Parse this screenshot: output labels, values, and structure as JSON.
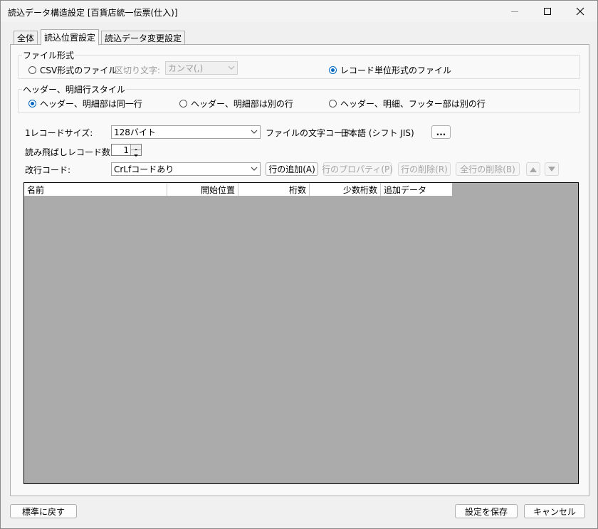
{
  "window": {
    "title": "読込データ構造設定 [百貨店統一伝票(仕入)]"
  },
  "tabs": [
    {
      "label": "全体"
    },
    {
      "label": "読込位置設定"
    },
    {
      "label": "読込データ変更設定"
    }
  ],
  "file_format": {
    "legend": "ファイル形式",
    "csv_label": "CSV形式のファイル",
    "delimiter_label": "区切り文字:",
    "delimiter_value": "カンマ(,)",
    "record_label": "レコード単位形式のファイル",
    "selected": "record"
  },
  "header_style": {
    "legend": "ヘッダー、明細行スタイル",
    "options": [
      {
        "label": "ヘッダー、明細部は同一行"
      },
      {
        "label": "ヘッダー、明細部は別の行"
      },
      {
        "label": "ヘッダー、明細、フッター部は別の行"
      }
    ],
    "selected": 0
  },
  "settings": {
    "record_size_label": "1レコードサイズ:",
    "record_size_value": "128バイト",
    "charset_label": "ファイルの文字コード:",
    "charset_value": "日本語 (シフト JIS)",
    "charset_button": "...",
    "skip_label": "読み飛ばしレコード数:",
    "skip_value": "1",
    "newline_label": "改行コード:",
    "newline_value": "CrLfコードあり"
  },
  "row_buttons": {
    "add": "行の追加(A)",
    "properties": "行のプロパティ(P)",
    "delete": "行の削除(R)",
    "delete_all": "全行の削除(B)"
  },
  "grid": {
    "columns": [
      "名前",
      "開始位置",
      "桁数",
      "少数桁数",
      "追加データ"
    ]
  },
  "footer": {
    "reset": "標準に戻す",
    "save": "設定を保存",
    "cancel": "キャンセル"
  },
  "colors": {
    "accent": "#0067c0",
    "grid_bg": "#ababab"
  }
}
